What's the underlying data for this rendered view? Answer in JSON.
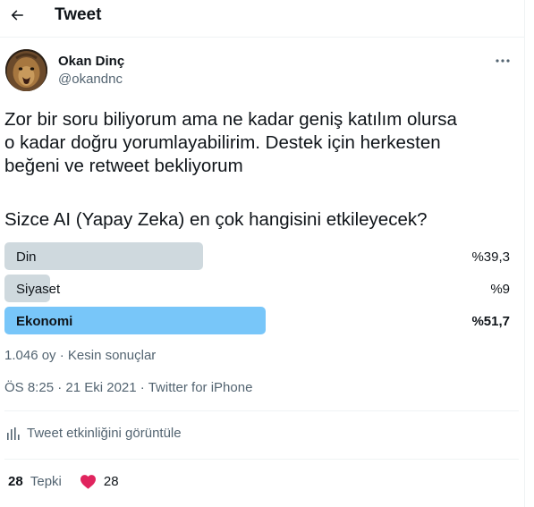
{
  "header": {
    "title": "Tweet",
    "back_icon": "arrow-left-icon"
  },
  "author": {
    "name": "Okan Dinç",
    "handle": "@okandnc",
    "avatar_icon": "lion-avatar"
  },
  "tweet": {
    "text": "Zor bir soru biliyorum ama ne kadar geniş katılım olursa\no kadar doğru yorumlayabilirim. Destek için herkesten\nbeğeni ve retweet bekliyorum",
    "poll_question": "Sizce AI (Yapay Zeka) en çok hangisini etkileyecek?"
  },
  "poll": {
    "options": [
      {
        "label": "Din",
        "percent_text": "%39,3",
        "share": 0.393,
        "winner": false
      },
      {
        "label": "Siyaset",
        "percent_text": "%9",
        "share": 0.09,
        "winner": false
      },
      {
        "label": "Ekonomi",
        "percent_text": "%51,7",
        "share": 0.517,
        "winner": true
      }
    ],
    "votes": "1.046 oy",
    "separator": "·",
    "status": "Kesin sonuçlar",
    "colors": {
      "bar": "#cfd9de",
      "winner_bar": "#78c6f9"
    }
  },
  "meta": {
    "time": "ÖS 8:25",
    "separator": "·",
    "date": "21 Eki 2021",
    "source": "Twitter for iPhone"
  },
  "analytics": {
    "label": "Tweet etkinliğini görüntüle",
    "icon": "bar-chart-icon"
  },
  "stats": {
    "reactions_count": "28",
    "reactions_label": "Tepki",
    "heart_count": "28",
    "heart_icon": "heart-icon"
  }
}
